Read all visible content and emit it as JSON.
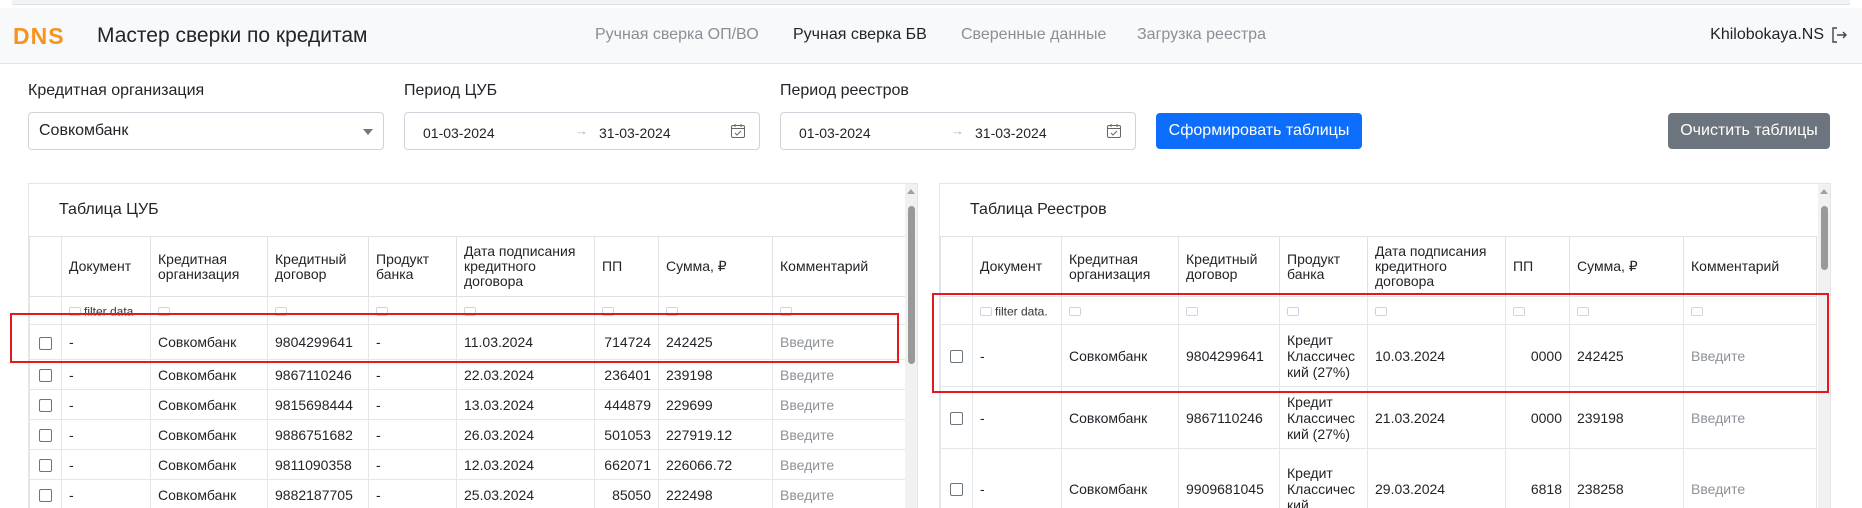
{
  "header": {
    "logo_text": "DNS",
    "title": "Мастер сверки по кредитам",
    "nav": [
      {
        "label": "Ручная сверка ОП/ВО",
        "active": false
      },
      {
        "label": "Ручная сверка БВ",
        "active": true
      },
      {
        "label": "Сверенные данные",
        "active": false
      },
      {
        "label": "Загрузка реестра",
        "active": false
      }
    ],
    "user": "Khilobokaya.NS",
    "logout_icon": "logout-icon",
    "brand_color": "#f7941d"
  },
  "filters": {
    "org_label": "Кредитная организация",
    "org_value": "Совкомбанк",
    "cub_period_label": "Период ЦУБ",
    "cub_from": "01-03-2024",
    "cub_to": "31-03-2024",
    "reg_period_label": "Период реестров",
    "reg_from": "01-03-2024",
    "reg_to": "31-03-2024",
    "range_arrow": "→",
    "build_button": "Сформировать таблицы",
    "clear_button": "Очистить таблицы"
  },
  "cub_table": {
    "title": "Таблица ЦУБ",
    "columns": [
      "Документ",
      "Кредитная организация",
      "Кредитный договор",
      "Продукт банка",
      "Дата подписания кредитного договора",
      "ПП",
      "Сумма, ₽",
      "Комментарий"
    ],
    "filter_placeholder": "filter data",
    "comment_placeholder": "Введите",
    "rows": [
      {
        "doc": "-",
        "org": "Совкомбанк",
        "contract": "9804299641",
        "product": "-",
        "date": "11.03.2024",
        "pp": "714724",
        "sum": "242425"
      },
      {
        "doc": "-",
        "org": "Совкомбанк",
        "contract": "9867110246",
        "product": "-",
        "date": "22.03.2024",
        "pp": "236401",
        "sum": "239198"
      },
      {
        "doc": "-",
        "org": "Совкомбанк",
        "contract": "9815698444",
        "product": "-",
        "date": "13.03.2024",
        "pp": "444879",
        "sum": "229699"
      },
      {
        "doc": "-",
        "org": "Совкомбанк",
        "contract": "9886751682",
        "product": "-",
        "date": "26.03.2024",
        "pp": "501053",
        "sum": "227919.12"
      },
      {
        "doc": "-",
        "org": "Совкомбанк",
        "contract": "9811090358",
        "product": "-",
        "date": "12.03.2024",
        "pp": "662071",
        "sum": "226066.72"
      },
      {
        "doc": "-",
        "org": "Совкомбанк",
        "contract": "9882187705",
        "product": "-",
        "date": "25.03.2024",
        "pp": "85050",
        "sum": "222498"
      }
    ]
  },
  "reg_table": {
    "title": "Таблица Реестров",
    "columns": [
      "Документ",
      "Кредитная организация",
      "Кредитный договор",
      "Продукт банка",
      "Дата подписания кредитного договора",
      "ПП",
      "Сумма, ₽",
      "Комментарий"
    ],
    "filter_placeholder": "filter data.",
    "comment_placeholder": "Введите",
    "rows": [
      {
        "doc": "-",
        "org": "Совкомбанк",
        "contract": "9804299641",
        "product": "Кредит Классичес кий (27%)",
        "date": "10.03.2024",
        "pp": "0000",
        "sum": "242425"
      },
      {
        "doc": "-",
        "org": "Совкомбанк",
        "contract": "9867110246",
        "product": "Кредит Классичес кий (27%)",
        "date": "21.03.2024",
        "pp": "0000",
        "sum": "239198"
      },
      {
        "doc": "-",
        "org": "Совкомбанк",
        "contract": "9909681045",
        "product": "Кредит Классичес кий",
        "date": "29.03.2024",
        "pp": "6818",
        "sum": "238258"
      }
    ]
  }
}
